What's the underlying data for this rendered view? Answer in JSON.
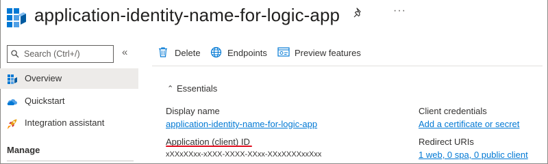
{
  "header": {
    "title": "application-identity-name-for-logic-app",
    "more_label": "···"
  },
  "sidebar": {
    "search": {
      "placeholder": "Search (Ctrl+/)"
    },
    "collapse_label": "«",
    "items": [
      {
        "label": "Overview",
        "icon": "overview-grid-icon",
        "active": true
      },
      {
        "label": "Quickstart",
        "icon": "cloud-quickstart-icon"
      },
      {
        "label": "Integration assistant",
        "icon": "rocket-icon"
      }
    ],
    "section": "Manage"
  },
  "toolbar": {
    "delete_label": "Delete",
    "endpoints_label": "Endpoints",
    "preview_label": "Preview features"
  },
  "essentials": {
    "toggle_label": "Essentials",
    "display_name_label": "Display name",
    "display_name_value": "application-identity-name-for-logic-app",
    "app_id_label": "Application (client) ID",
    "app_id_value": "xXXxXXxx-xXXX-XXXX-XXxx-XXxXXXXxxXxx",
    "client_credentials_label": "Client credentials",
    "client_credentials_value": "Add a certificate or secret",
    "redirect_uris_label": "Redirect URIs",
    "redirect_uris_value": "1 web, 0 spa, 0 public client"
  },
  "colors": {
    "link": "#0078d4",
    "accent_blue": "#0078d4",
    "highlight_underline": "#e00b1c",
    "active_nav_bg": "#edebe9"
  }
}
